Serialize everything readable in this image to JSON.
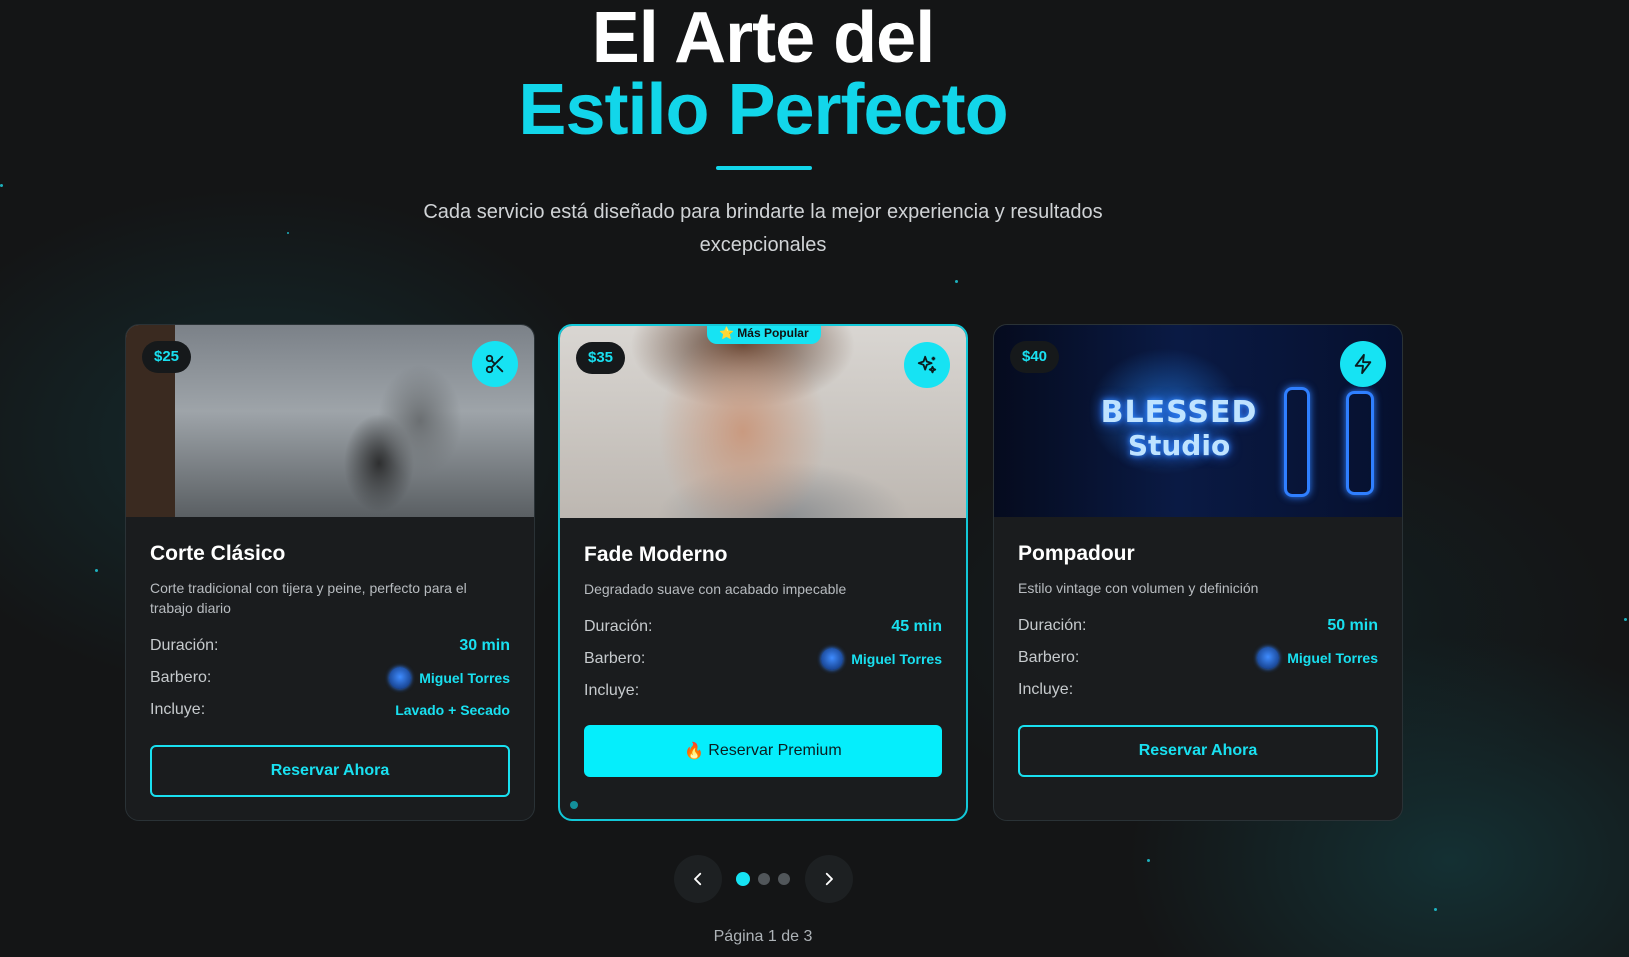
{
  "hero": {
    "title_line1": "El Arte del",
    "title_line2": "Estilo Perfecto",
    "subtitle": "Cada servicio está diseñado para brindarte la mejor experiencia y resultados excepcionales"
  },
  "cards": [
    {
      "price": "$25",
      "icon": "scissors-icon",
      "title": "Corte Clásico",
      "description": "Corte tradicional con tijera y peine, perfecto para el trabajo diario",
      "duration_label": "Duración:",
      "duration": "30 min",
      "barber_label": "Barbero:",
      "barber": "Miguel Torres",
      "includes_label": "Incluye:",
      "includes": "Lavado + Secado",
      "button": "Reservar Ahora"
    },
    {
      "price": "$35",
      "icon": "sparkles-icon",
      "badge": "⭐ Más Popular",
      "title": "Fade Moderno",
      "description": "Degradado suave con acabado impecable",
      "duration_label": "Duración:",
      "duration": "45 min",
      "barber_label": "Barbero:",
      "barber": "Miguel Torres",
      "includes_label": "Incluye:",
      "includes": "",
      "button_icon": "🔥",
      "button": "Reservar Premium"
    },
    {
      "price": "$40",
      "icon": "lightning-icon",
      "neon_line1": "BLESSED",
      "neon_line2": "Studio",
      "title": "Pompadour",
      "description": "Estilo vintage con volumen y definición",
      "duration_label": "Duración:",
      "duration": "50 min",
      "barber_label": "Barbero:",
      "barber": "Miguel Torres",
      "includes_label": "Incluye:",
      "includes": "",
      "button": "Reservar Ahora"
    }
  ],
  "pagination": {
    "label": "Página 1 de 3",
    "current_page": 1,
    "total_pages": 3
  },
  "colors": {
    "accent": "#16e3f3",
    "background": "#141516",
    "card": "#1a1c1e"
  }
}
